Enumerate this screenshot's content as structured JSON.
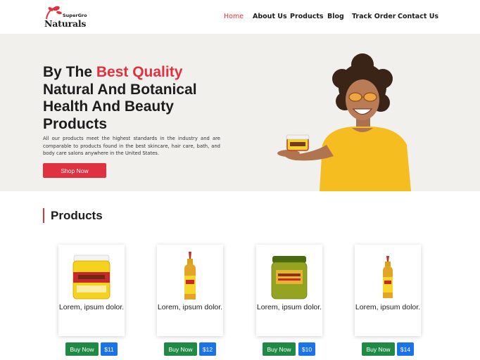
{
  "brand": {
    "top": "SuperGro",
    "main": "Naturals"
  },
  "nav": {
    "items": [
      {
        "label": "Home",
        "active": true
      },
      {
        "label": "About Us"
      },
      {
        "label": "Products"
      },
      {
        "label": "Blog"
      },
      {
        "label": "Track Order"
      },
      {
        "label": "Contact Us"
      }
    ]
  },
  "hero": {
    "title_prefix": "By The ",
    "title_accent": "Best Quality",
    "title_rest": "Natural And Botanical Health And Beauty Products",
    "description": "All our products meet the highest standards in the industry and are comparable to products found in the best skincare, hair care, bath, and body care salons anywhere in the United States.",
    "cta": "Shop Now"
  },
  "products": {
    "heading": "Products",
    "items": [
      {
        "caption": "Lorem, ipsum dolor.",
        "buy": "Buy Now",
        "price": "$11"
      },
      {
        "caption": "Lorem, ipsum dolor.",
        "buy": "Buy Now",
        "price": "$12"
      },
      {
        "caption": "Lorem, ipsum dolor.",
        "buy": "Buy Now",
        "price": "$10"
      },
      {
        "caption": "Lorem, ipsum dolor.",
        "buy": "Buy Now",
        "price": "$14"
      }
    ]
  },
  "colors": {
    "accent": "#e0313f",
    "buy": "#1e8a46",
    "price": "#1a73e8",
    "hero_bg": "#f1f0ed"
  }
}
